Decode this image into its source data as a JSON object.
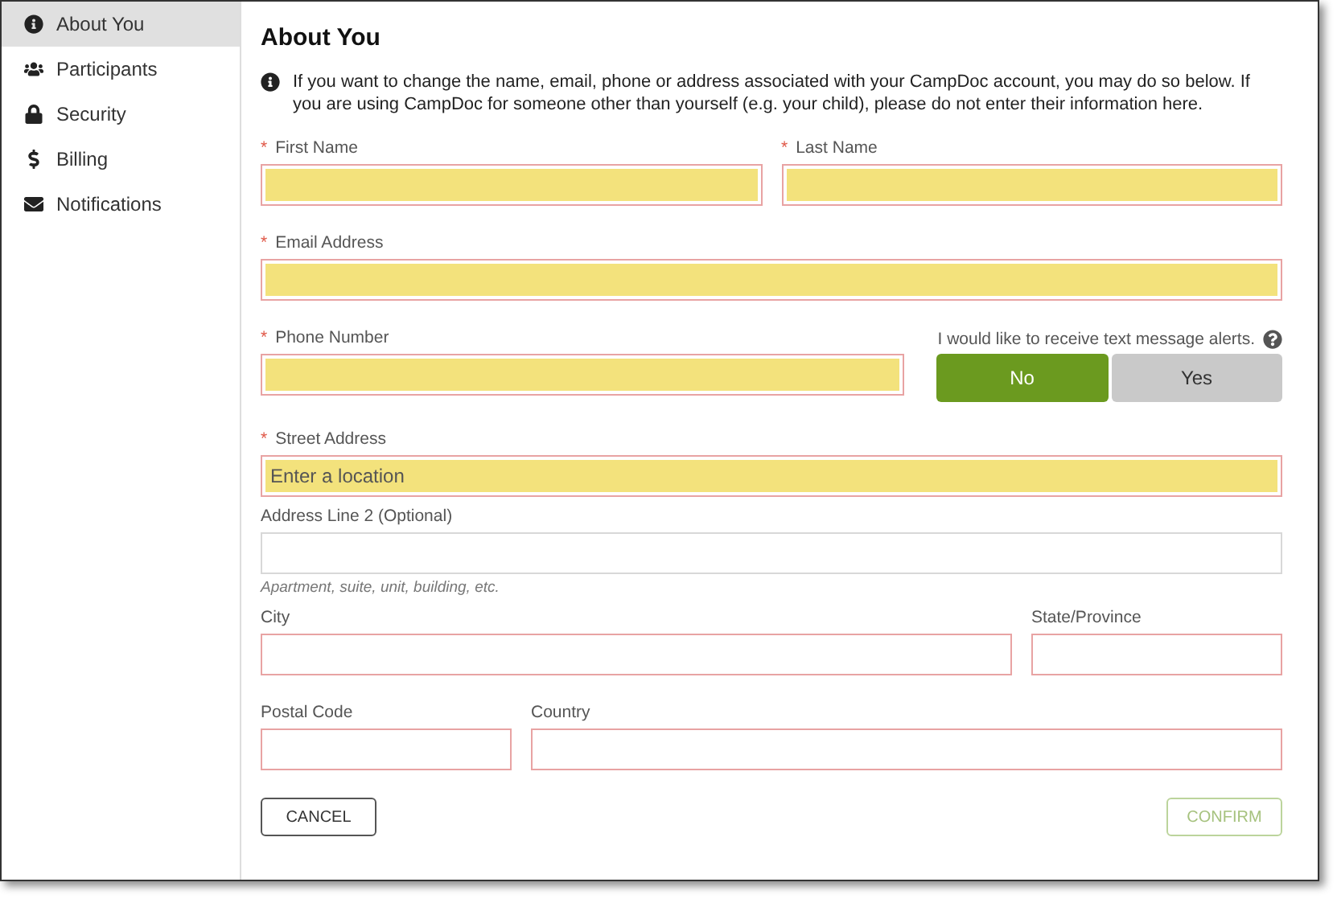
{
  "sidebar": {
    "items": [
      {
        "label": "About You",
        "selected": true
      },
      {
        "label": "Participants",
        "selected": false
      },
      {
        "label": "Security",
        "selected": false
      },
      {
        "label": "Billing",
        "selected": false
      },
      {
        "label": "Notifications",
        "selected": false
      }
    ]
  },
  "title": "About You",
  "notice": "If you want to change the name, email, phone or address associated with your CampDoc account, you may do so below. If you are using CampDoc for someone other than yourself (e.g. your child), please do not enter their information here.",
  "rows": [
    {
      "fields": [
        {
          "kind": "input",
          "required_mark": "*",
          "label": "First Name",
          "invalid": true,
          "autofilled": true
        },
        {
          "kind": "input",
          "required_mark": "*",
          "label": "Last Name",
          "invalid": true,
          "autofilled": true
        }
      ]
    },
    {
      "fields": [
        {
          "kind": "input",
          "required_mark": "*",
          "label": "Email Address",
          "invalid": true,
          "autofilled": true
        }
      ]
    },
    {
      "fields": [
        {
          "kind": "input",
          "required_mark": "*",
          "label": "Phone Number",
          "invalid": true,
          "autofilled": true
        },
        {
          "kind": "toggle",
          "label": "I would like to receive text message alerts.",
          "options": [
            {
              "label": "No",
              "selected": true
            },
            {
              "label": "Yes",
              "selected": false
            }
          ]
        }
      ]
    },
    {
      "fields": [
        {
          "kind": "input",
          "required_mark": "*",
          "label": "Street Address",
          "invalid": true,
          "autofilled": true,
          "placeholder": "Enter a location"
        }
      ]
    },
    {
      "fields": [
        {
          "kind": "input",
          "label": "Address Line 2 (Optional)",
          "invalid": false,
          "autofilled": false,
          "hint": "Apartment, suite, unit, building, etc."
        }
      ]
    },
    {
      "fields": [
        {
          "kind": "input",
          "label": "City",
          "invalid": true,
          "autofilled": false
        },
        {
          "kind": "input",
          "label": "State/Province",
          "invalid": true,
          "autofilled": false
        }
      ]
    },
    {
      "fields": [
        {
          "kind": "input",
          "label": "Postal Code",
          "invalid": true,
          "autofilled": false
        },
        {
          "kind": "input",
          "label": "Country",
          "invalid": true,
          "autofilled": false
        }
      ]
    }
  ],
  "buttons": {
    "cancel": "CANCEL",
    "confirm": {
      "label": "CONFIRM",
      "disabled": true
    }
  }
}
